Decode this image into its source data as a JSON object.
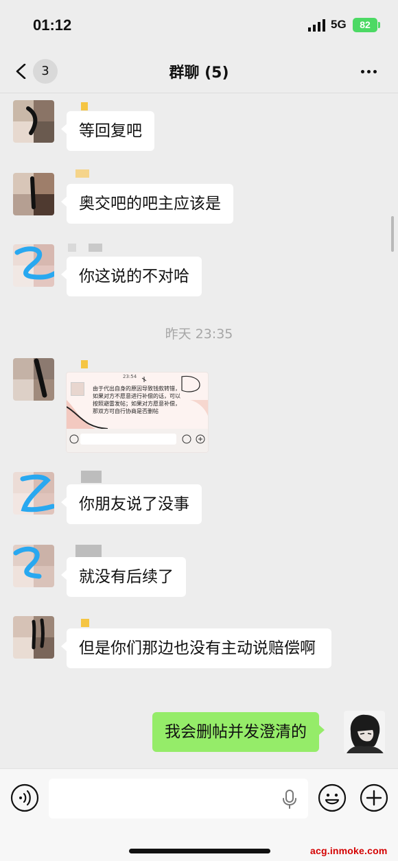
{
  "status_bar": {
    "time": "01:12",
    "network": "5G",
    "battery": "82"
  },
  "nav": {
    "unread_count": "3",
    "title": "群聊 (5)"
  },
  "messages": [
    {
      "text": "等回复吧"
    },
    {
      "text": "奥交吧的吧主应该是"
    },
    {
      "text": "你这说的不对哈"
    },
    {
      "image_caption": "由于代出自身的原因导致钱款转错，如果对方不愿意进行补偿的话，可以按照避雷发帖；如果对方愿意补偿，那双方可自行协商是否删帖",
      "image_time": "23:54"
    },
    {
      "text": "你朋友说了没事"
    },
    {
      "text": "就没有后续了"
    },
    {
      "text": "但是你们那边也没有主动说赔偿啊"
    },
    {
      "text": "我会删帖并发澄清的"
    }
  ],
  "timestamp": "昨天 23:35",
  "input_bar": {
    "message_value": ""
  },
  "watermark": "acg.inmoke.com",
  "colors": {
    "background": "#ededed",
    "incoming_bubble": "#ffffff",
    "outgoing_bubble": "#95ec69",
    "battery": "#4cd964",
    "watermark": "#d40000",
    "annotation_blue": "#29a8f0"
  }
}
